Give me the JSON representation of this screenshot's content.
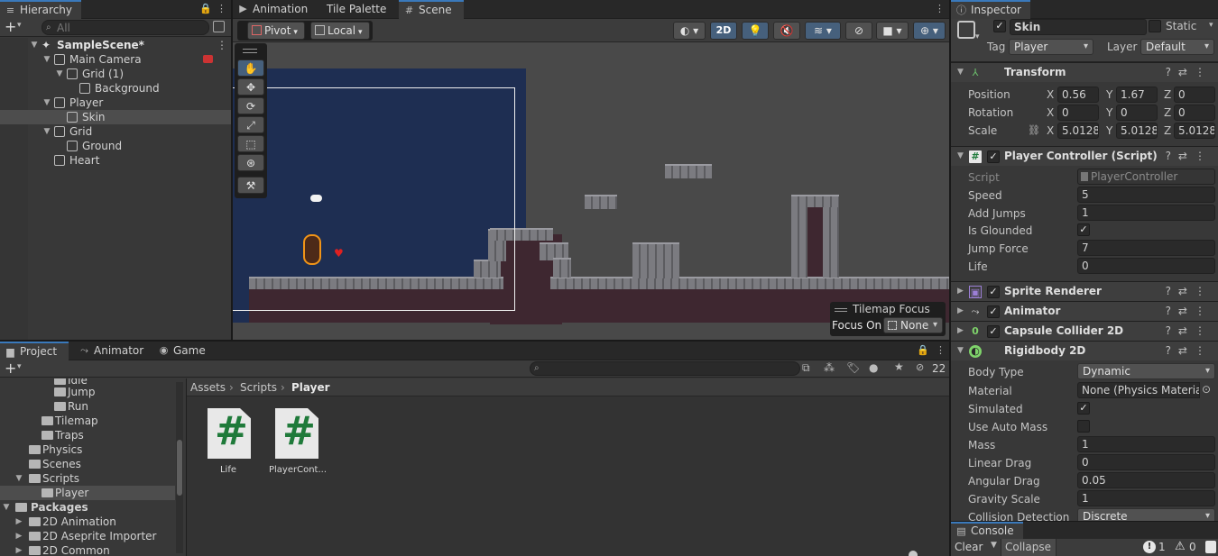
{
  "hierarchy": {
    "tab_label": "Hierarchy",
    "search_placeholder": "All",
    "scene_name": "SampleScene*",
    "items": [
      {
        "label": "Main Camera"
      },
      {
        "label": "Grid (1)"
      },
      {
        "label": "Background"
      },
      {
        "label": "Player"
      },
      {
        "label": "Skin"
      },
      {
        "label": "Grid"
      },
      {
        "label": "Ground"
      },
      {
        "label": "Heart"
      }
    ]
  },
  "scene_tabs": [
    {
      "label": "Animation"
    },
    {
      "label": "Tile Palette"
    },
    {
      "label": "Scene"
    }
  ],
  "scene_toolbar": {
    "pivot": "Pivot",
    "local": "Local",
    "mode_2d": "2D"
  },
  "tilemap_focus": {
    "title": "Tilemap Focus",
    "focus_label": "Focus On",
    "focus_value": "None"
  },
  "project": {
    "tabs": [
      {
        "label": "Project"
      },
      {
        "label": "Animator"
      },
      {
        "label": "Game"
      }
    ],
    "hidden_count": "22",
    "breadcrumb": [
      "Assets",
      "Scripts",
      "Player"
    ],
    "tree": [
      {
        "label": "Idle"
      },
      {
        "label": "Jump"
      },
      {
        "label": "Run"
      },
      {
        "label": "Tilemap"
      },
      {
        "label": "Traps"
      },
      {
        "label": "Physics"
      },
      {
        "label": "Scenes"
      },
      {
        "label": "Scripts"
      },
      {
        "label": "Player"
      },
      {
        "label": "Packages"
      },
      {
        "label": "2D Animation"
      },
      {
        "label": "2D Aseprite Importer"
      },
      {
        "label": "2D Common"
      }
    ],
    "assets": [
      {
        "label": "Life",
        "icon": "#"
      },
      {
        "label": "PlayerCont...",
        "icon": "#"
      }
    ]
  },
  "inspector": {
    "tab_label": "Inspector",
    "object_name": "Skin",
    "static_label": "Static",
    "tag_label": "Tag",
    "tag_value": "Player",
    "layer_label": "Layer",
    "layer_value": "Default",
    "transform": {
      "title": "Transform",
      "position_label": "Position",
      "rotation_label": "Rotation",
      "scale_label": "Scale",
      "position": {
        "x": "0.56",
        "y": "1.67",
        "z": "0"
      },
      "rotation": {
        "x": "0",
        "y": "0",
        "z": "0"
      },
      "scale": {
        "x": "5.0128",
        "y": "5.0128",
        "z": "5.0128"
      }
    },
    "player_controller": {
      "title": "Player Controller (Script)",
      "script_label": "Script",
      "script_value": "PlayerController",
      "speed_label": "Speed",
      "speed_value": "5",
      "add_jumps_label": "Add Jumps",
      "add_jumps_value": "1",
      "is_grounded_label": "Is Glounded",
      "jump_force_label": "Jump Force",
      "jump_force_value": "7",
      "life_label": "Life",
      "life_value": "0"
    },
    "components": [
      {
        "title": "Sprite Renderer"
      },
      {
        "title": "Animator"
      },
      {
        "title": "Capsule Collider 2D"
      },
      {
        "title": "Rigidbody 2D"
      }
    ],
    "rigidbody": {
      "body_type_label": "Body Type",
      "body_type_value": "Dynamic",
      "material_label": "Material",
      "material_value": "None (Physics Material",
      "simulated_label": "Simulated",
      "auto_mass_label": "Use Auto Mass",
      "mass_label": "Mass",
      "mass_value": "1",
      "linear_drag_label": "Linear Drag",
      "linear_drag_value": "0",
      "angular_drag_label": "Angular Drag",
      "angular_drag_value": "0.05",
      "gravity_label": "Gravity Scale",
      "gravity_value": "1",
      "collision_label": "Collision Detection",
      "collision_value": "Discrete"
    }
  },
  "console": {
    "tab_label": "Console",
    "clear_label": "Clear",
    "collapse_label": "Collapse",
    "error_count": "1",
    "warning_count": "0"
  }
}
